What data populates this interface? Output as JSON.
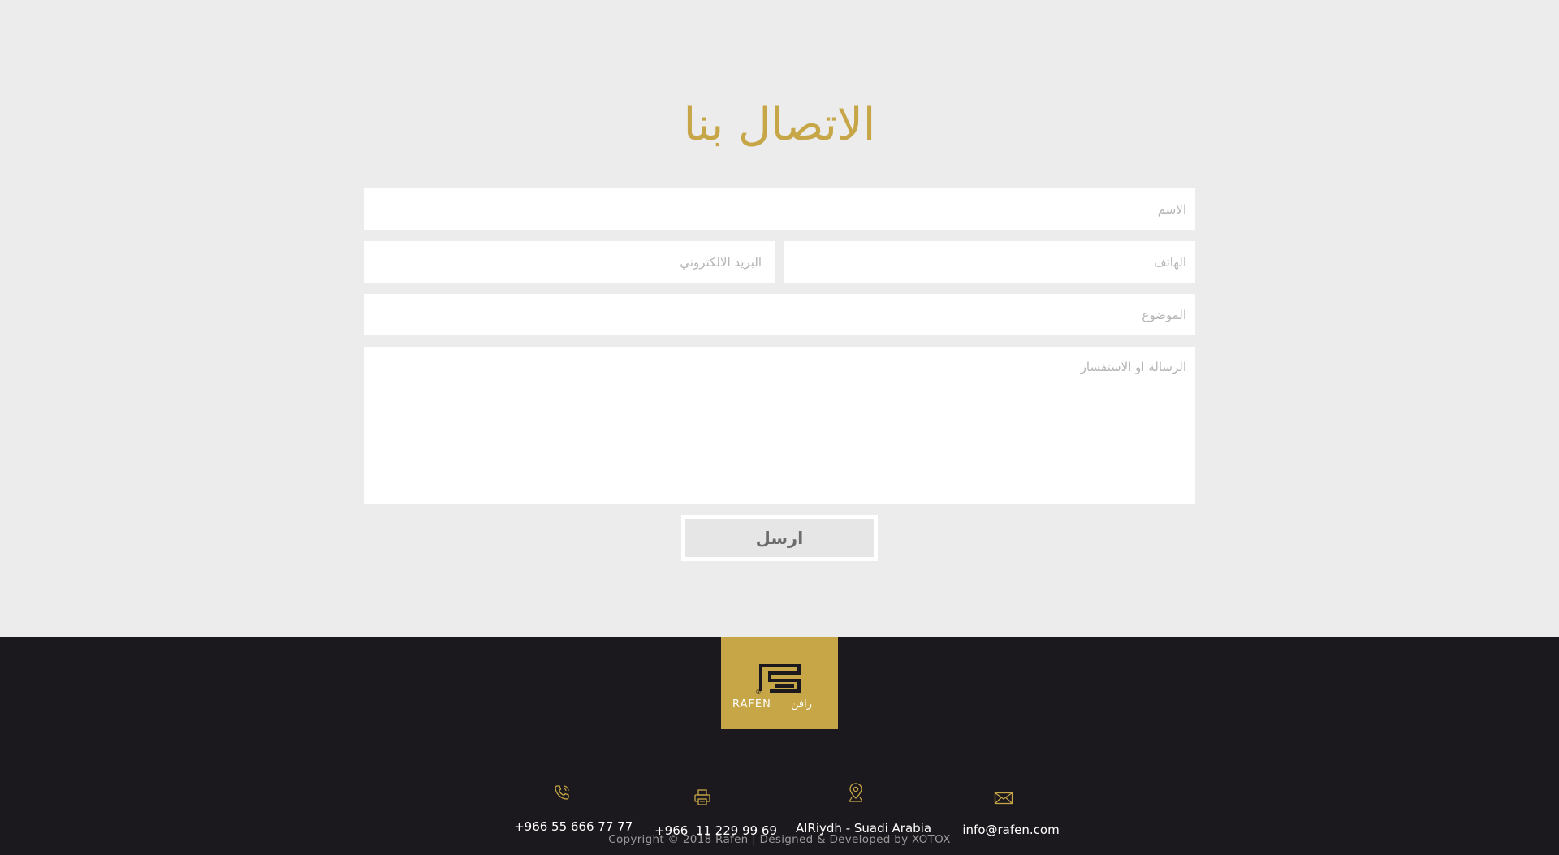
{
  "form": {
    "title": "الاتصال بنا",
    "name_placeholder": "الاسم",
    "email_placeholder": "البريد الالكتروني",
    "phone_placeholder": "الهاتف",
    "subject_placeholder": "الموضوع",
    "message_placeholder": "الرسالة او الاستفسار",
    "send_label": "ارسل"
  },
  "footer": {
    "logo_text_latin": "RAFEN",
    "logo_text_arabic": "رافن",
    "logo_registered": "®",
    "contacts": [
      {
        "icon": "phone-icon",
        "text": "+966 55 666 77 77"
      },
      {
        "icon": "fax-icon",
        "text": "+966  11 229 99 69"
      },
      {
        "icon": "location-pin-icon",
        "text": "AlRiydh - Suadi Arabia"
      },
      {
        "icon": "envelope-icon",
        "text": "info@rafen.com"
      }
    ],
    "copyright": "Copyright © 2018 Rafen  |  Designed & Developed by XOTOX"
  },
  "colors": {
    "gold": "#c6a646",
    "footer_bg": "#1b191d",
    "page_bg": "#ececec"
  }
}
